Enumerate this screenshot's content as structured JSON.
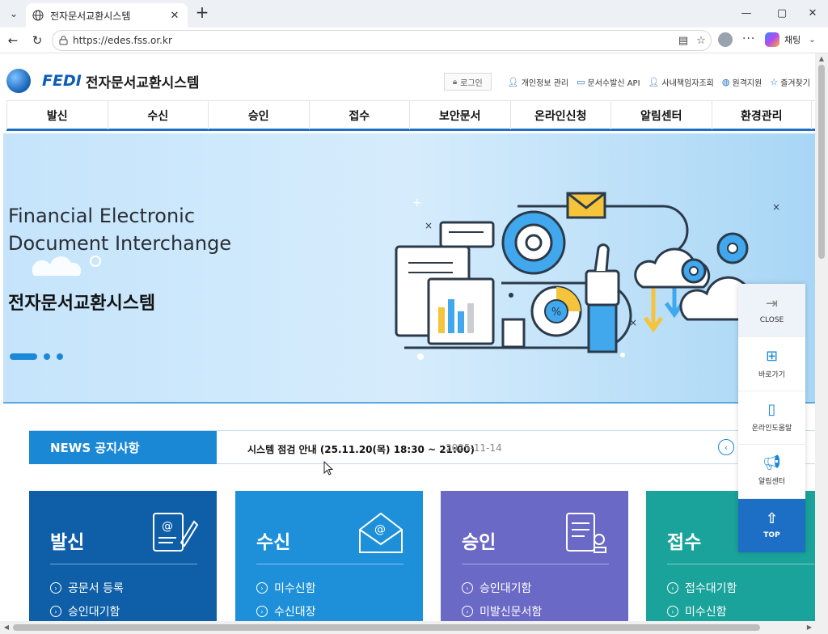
{
  "browser": {
    "tab_title": "전자문서교환시스템",
    "url": "https://edes.fss.or.kr",
    "copilot_label": "채팅"
  },
  "site": {
    "logo_brand": "FEDI",
    "logo_name": "전자문서교환시스템",
    "utils": {
      "login": "로그인",
      "privacy": "개인정보 관리",
      "api": "문서수발신 API",
      "officer": "사내책임자조회",
      "remote": "원격지원",
      "favorites": "즐겨찾기"
    },
    "gnb": [
      "발신",
      "수신",
      "승인",
      "접수",
      "보안문서",
      "온라인신청",
      "알림센터",
      "환경관리"
    ]
  },
  "hero": {
    "en_line1": "Financial Electronic",
    "en_line2": "Document Interchange",
    "ko_title": "전자문서교환시스템",
    "art_percent": "%"
  },
  "news": {
    "label": "NEWS 공지사항",
    "headline": "시스템 점검 안내 (25.11.20(목) 18:30 ~ 21:00)",
    "date": "2025-11-14"
  },
  "cards": [
    {
      "title": "발신",
      "color": "#0e5fa8",
      "links": [
        "공문서 등록",
        "승인대기함"
      ]
    },
    {
      "title": "수신",
      "color": "#1e90d9",
      "links": [
        "미수신함",
        "수신대장"
      ]
    },
    {
      "title": "승인",
      "color": "#6a69c6",
      "links": [
        "승인대기함",
        "미발신문서함"
      ]
    },
    {
      "title": "접수",
      "color": "#1aa39a",
      "links": [
        "접수대기함",
        "미수신함"
      ]
    }
  ],
  "quick_menu": {
    "close": "CLOSE",
    "shortcut": "바로가기",
    "help": "온라인도움말",
    "notice": "알림센터",
    "top": "TOP"
  }
}
